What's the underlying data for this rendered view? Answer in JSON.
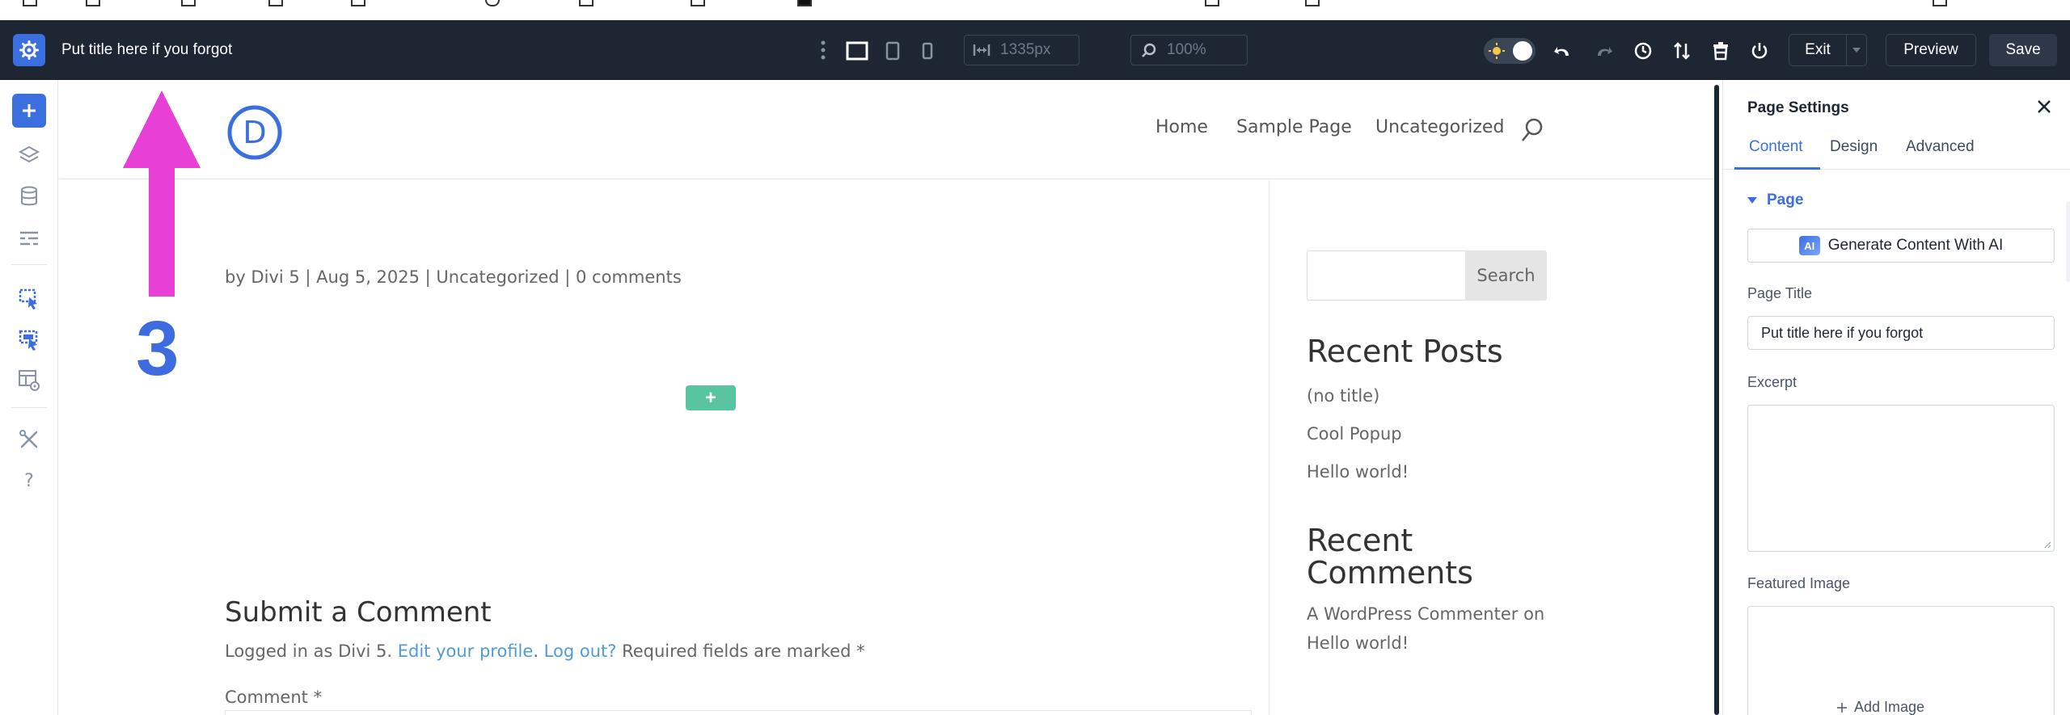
{
  "toolbar": {
    "page_title": "Put title here if you forgot",
    "width_value": "1335px",
    "zoom_value": "100%",
    "exit_label": "Exit",
    "preview_label": "Preview",
    "save_label": "Save"
  },
  "site": {
    "logo_letter": "D",
    "nav": [
      "Home",
      "Sample Page",
      "Uncategorized"
    ]
  },
  "post": {
    "meta": "by Divi 5 | Aug 5, 2025 | Uncategorized | 0 comments",
    "add_row_symbol": "+"
  },
  "comments": {
    "heading": "Submit a Comment",
    "logged_prefix": "Logged in as Divi 5. ",
    "edit_profile": "Edit your profile",
    "dot": ". ",
    "logout": "Log out?",
    "required": " Required fields are marked *",
    "comment_label": "Comment *"
  },
  "sidebar": {
    "search_button": "Search",
    "recent_posts_heading": "Recent Posts",
    "recent_posts": [
      "(no title)",
      "Cool Popup",
      "Hello world!"
    ],
    "recent_comments_heading_line1": "Recent",
    "recent_comments_heading_line2": "Comments",
    "recent_comment_line1": "A WordPress Commenter on",
    "recent_comment_line2": "Hello world!"
  },
  "annotation": {
    "number": "3",
    "color": "#e83fd6"
  },
  "panel": {
    "title": "Page Settings",
    "tabs": [
      "Content",
      "Design",
      "Advanced"
    ],
    "active_tab": "Content",
    "section": "Page",
    "ai_badge": "AI",
    "ai_button": "Generate Content With AI",
    "page_title_label": "Page Title",
    "page_title_value": "Put title here if you forgot",
    "excerpt_label": "Excerpt",
    "featured_image_label": "Featured Image",
    "add_image": "Add Image"
  },
  "colors": {
    "toolbar_bg": "#1e2633",
    "accent": "#3b6fe0",
    "add_row": "#58c4a0",
    "link": "#4f9bd3"
  }
}
